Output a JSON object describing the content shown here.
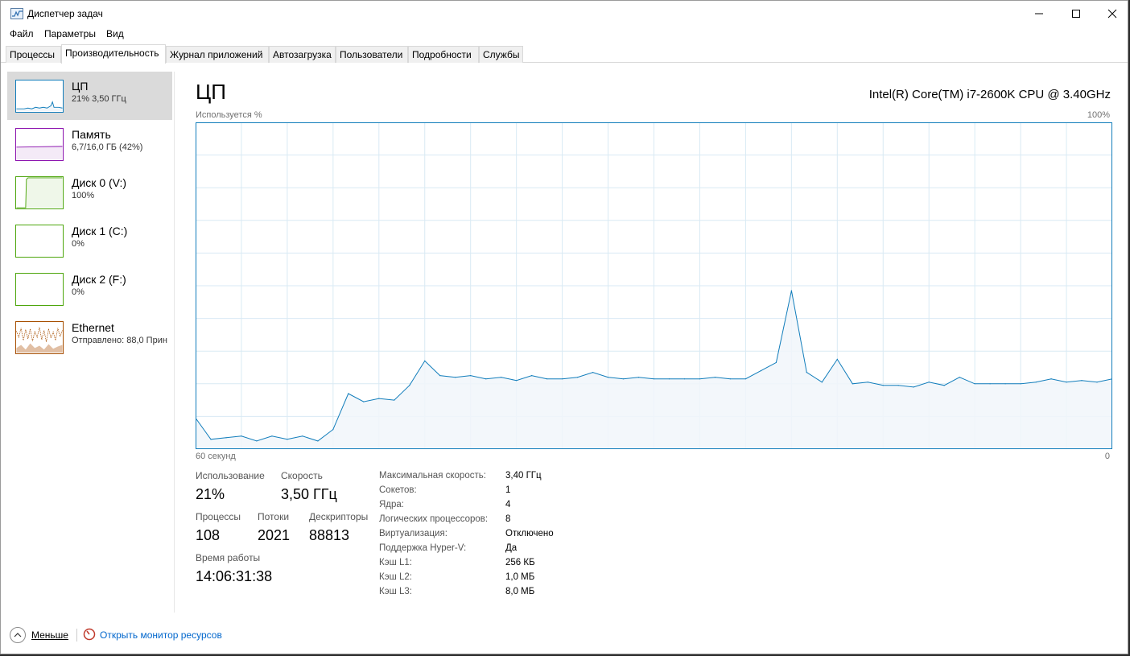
{
  "window": {
    "title": "Диспетчер задач"
  },
  "menu": [
    "Файл",
    "Параметры",
    "Вид"
  ],
  "tabs": [
    "Процессы",
    "Производительность",
    "Журнал приложений",
    "Автозагрузка",
    "Пользователи",
    "Подробности",
    "Службы"
  ],
  "active_tab": "Производительность",
  "sidebar": {
    "items": [
      {
        "title": "ЦП",
        "sub": "21% 3,50 ГГц",
        "color": "#117dbb"
      },
      {
        "title": "Память",
        "sub": "6,7/16,0 ГБ (42%)",
        "color": "#8b12ae"
      },
      {
        "title": "Диск 0 (V:)",
        "sub": "100%",
        "color": "#4da60c"
      },
      {
        "title": "Диск 1 (C:)",
        "sub": "0%",
        "color": "#4da60c"
      },
      {
        "title": "Диск 2 (F:)",
        "sub": "0%",
        "color": "#4da60c"
      },
      {
        "title": "Ethernet",
        "sub": "Отправлено: 88,0 Прин",
        "color": "#a74f01"
      }
    ]
  },
  "main": {
    "title": "ЦП",
    "cpu_model": "Intel(R) Core(TM) i7-2600K CPU @ 3.40GHz",
    "util_label": "Используется %",
    "util_max": "100%",
    "time_left": "60 секунд",
    "time_right": "0"
  },
  "stats": {
    "usage_label": "Использование",
    "usage_value": "21%",
    "speed_label": "Скорость",
    "speed_value": "3,50 ГГц",
    "processes_label": "Процессы",
    "processes_value": "108",
    "threads_label": "Потоки",
    "threads_value": "2021",
    "handles_label": "Дескрипторы",
    "handles_value": "88813",
    "uptime_label": "Время работы",
    "uptime_value": "14:06:31:38"
  },
  "info": [
    {
      "label": "Максимальная скорость:",
      "value": "3,40 ГГц"
    },
    {
      "label": "Сокетов:",
      "value": "1"
    },
    {
      "label": "Ядра:",
      "value": "4"
    },
    {
      "label": "Логических процессоров:",
      "value": "8"
    },
    {
      "label": "Виртуализация:",
      "value": "Отключено"
    },
    {
      "label": "Поддержка Hyper-V:",
      "value": "Да"
    },
    {
      "label": "Кэш L1:",
      "value": "256 КБ"
    },
    {
      "label": "Кэш L2:",
      "value": "1,0 МБ"
    },
    {
      "label": "Кэш L3:",
      "value": "8,0 МБ"
    }
  ],
  "footer": {
    "less_label": "Меньше",
    "monitor_link": "Открыть монитор ресурсов"
  },
  "chart_data": {
    "type": "area",
    "ylim": [
      0,
      100
    ],
    "xlim": [
      60,
      0
    ],
    "x": [
      60,
      59,
      58,
      57,
      56,
      55,
      54,
      53,
      52,
      51,
      50,
      49,
      48,
      47,
      46,
      45,
      44,
      43,
      42,
      41,
      40,
      39,
      38,
      37,
      36,
      35,
      34,
      33,
      32,
      31,
      30,
      29,
      28,
      27,
      26,
      25,
      24,
      23,
      22,
      21,
      20,
      19,
      18,
      17,
      16,
      15,
      14,
      13,
      12,
      11,
      10,
      9,
      8,
      7,
      6,
      5,
      4,
      3,
      2,
      1,
      0
    ],
    "values": [
      9.5,
      3,
      3.5,
      4,
      2.5,
      4,
      3,
      4,
      2.5,
      6,
      17,
      14.5,
      15.5,
      15,
      19.5,
      27,
      22.5,
      22,
      22.5,
      21.5,
      22,
      21,
      22.5,
      21.5,
      21.5,
      22,
      23.5,
      22,
      21.5,
      22,
      21.5,
      21.5,
      21.5,
      21.5,
      22,
      21.5,
      21.5,
      24,
      26.5,
      48.5,
      23.5,
      20.5,
      27.5,
      20,
      20.5,
      19.5,
      19.5,
      19,
      20.5,
      19.5,
      22,
      20,
      20,
      20,
      20,
      20.5,
      21.5,
      20.5,
      21,
      20.5,
      21.5
    ],
    "line_color": "#117dbb",
    "fill_color": "#f1f6fa",
    "grid_color": "#d9eaf4",
    "grid": true
  }
}
